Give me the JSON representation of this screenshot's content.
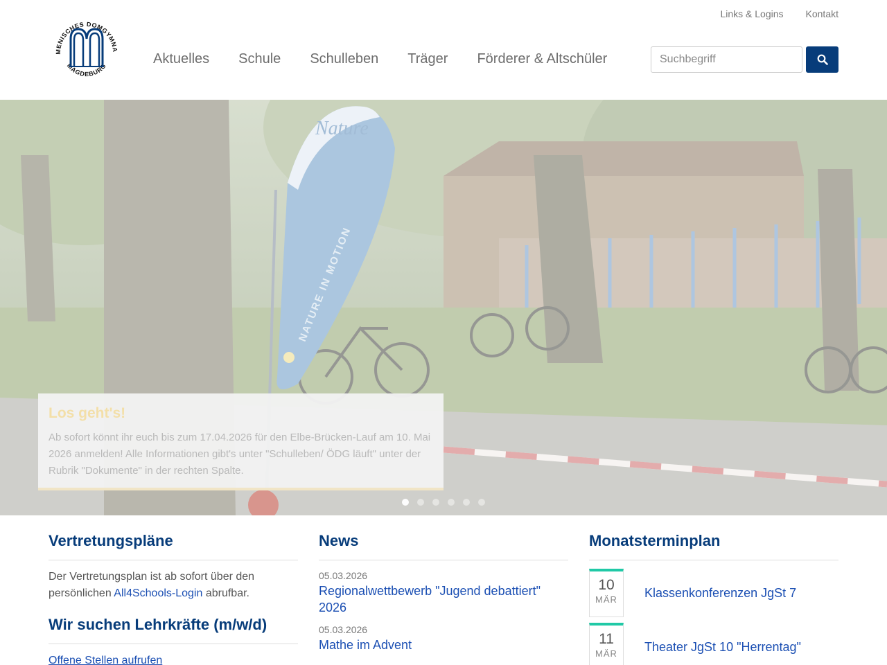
{
  "logo": {
    "text_top": "ÖKUMENISCHES DOMGYMNASIUM",
    "text_bottom": "MAGDEBURG",
    "color": "#073c7a"
  },
  "topnav": {
    "items": [
      {
        "label": "Links & Logins"
      },
      {
        "label": "Kontakt"
      }
    ]
  },
  "mainnav": {
    "items": [
      {
        "label": "Aktuelles"
      },
      {
        "label": "Schule"
      },
      {
        "label": "Schulleben"
      },
      {
        "label": "Träger"
      },
      {
        "label": "Förderer & Altschüler"
      }
    ]
  },
  "search": {
    "placeholder": "Suchbegriff",
    "icon": "search-icon",
    "button_color": "#073c7a"
  },
  "hero": {
    "flag_text_1": "Nature",
    "flag_text_2": "NATURE IN MOTION",
    "caption_title": "Los geht's!",
    "caption_text": "Ab sofort könnt ihr euch bis zum 17.04.2026 für den Elbe-Brücken-Lauf am 10. Mai 2026 anmelden! Alle Informationen gibt's unter \"Schulleben/ ÖDG läuft\" unter der Rubrik \"Dokumente\" in der rechten Spalte.",
    "slides_total": 6,
    "slide_active": 1
  },
  "vertretung": {
    "title": "Vertretungspläne",
    "text_before": "Der Vertretungsplan ist ab sofort über den persönlichen ",
    "link": "All4Schools-Login",
    "text_after": " abrufbar."
  },
  "jobs": {
    "title": "Wir suchen Lehrkräfte (m/w/d)",
    "link": "Offene Stellen aufrufen"
  },
  "news": {
    "title": "News",
    "items": [
      {
        "date": "05.03.2026",
        "title": "Regionalwettbewerb \"Jugend debattiert\" 2026"
      },
      {
        "date": "05.03.2026",
        "title": "Mathe im Advent"
      }
    ]
  },
  "termine": {
    "title": "Monatsterminplan",
    "accent": "#20c9a6",
    "items": [
      {
        "day": "10",
        "month": "MÄR",
        "title": "Klassenkonferenzen JgSt 7"
      },
      {
        "day": "11",
        "month": "MÄR",
        "title": "Theater JgSt 10 \"Herrentag\""
      }
    ]
  }
}
